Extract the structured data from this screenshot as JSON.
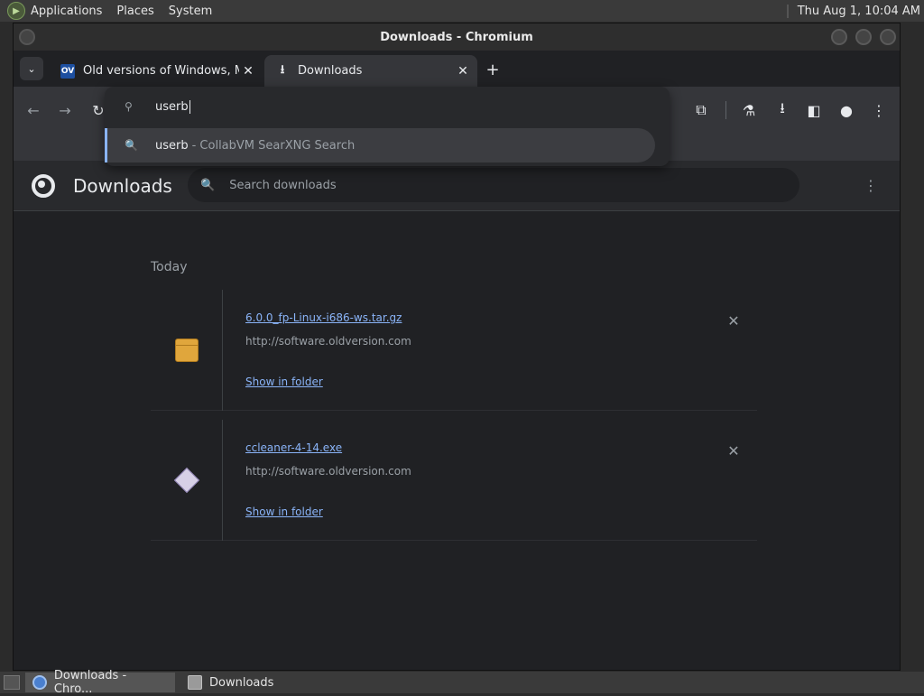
{
  "top_panel": {
    "menus": [
      "Applications",
      "Places",
      "System"
    ],
    "clock": "Thu Aug  1, 10:04 AM"
  },
  "window": {
    "title": "Downloads - Chromium"
  },
  "tabs": [
    {
      "label": "Old versions of Windows, Ma",
      "favicon": "OV"
    },
    {
      "label": "Downloads"
    }
  ],
  "omnibox": {
    "query": "userb",
    "suggestion_query": "userb",
    "suggestion_source": "- CollabVM SearXNG Search"
  },
  "downloads": {
    "title": "Downloads",
    "search_placeholder": "Search downloads",
    "section": "Today",
    "items": [
      {
        "name": "6.0.0_fp-Linux-i686-ws.tar.gz",
        "url": "http://software.oldversion.com",
        "action": "Show in folder",
        "icon": "package-icon"
      },
      {
        "name": "ccleaner-4-14.exe",
        "url": "http://software.oldversion.com",
        "action": "Show in folder",
        "icon": "exe-icon"
      }
    ]
  },
  "taskbar": {
    "tasks": [
      "Downloads - Chro...",
      "Downloads"
    ]
  }
}
